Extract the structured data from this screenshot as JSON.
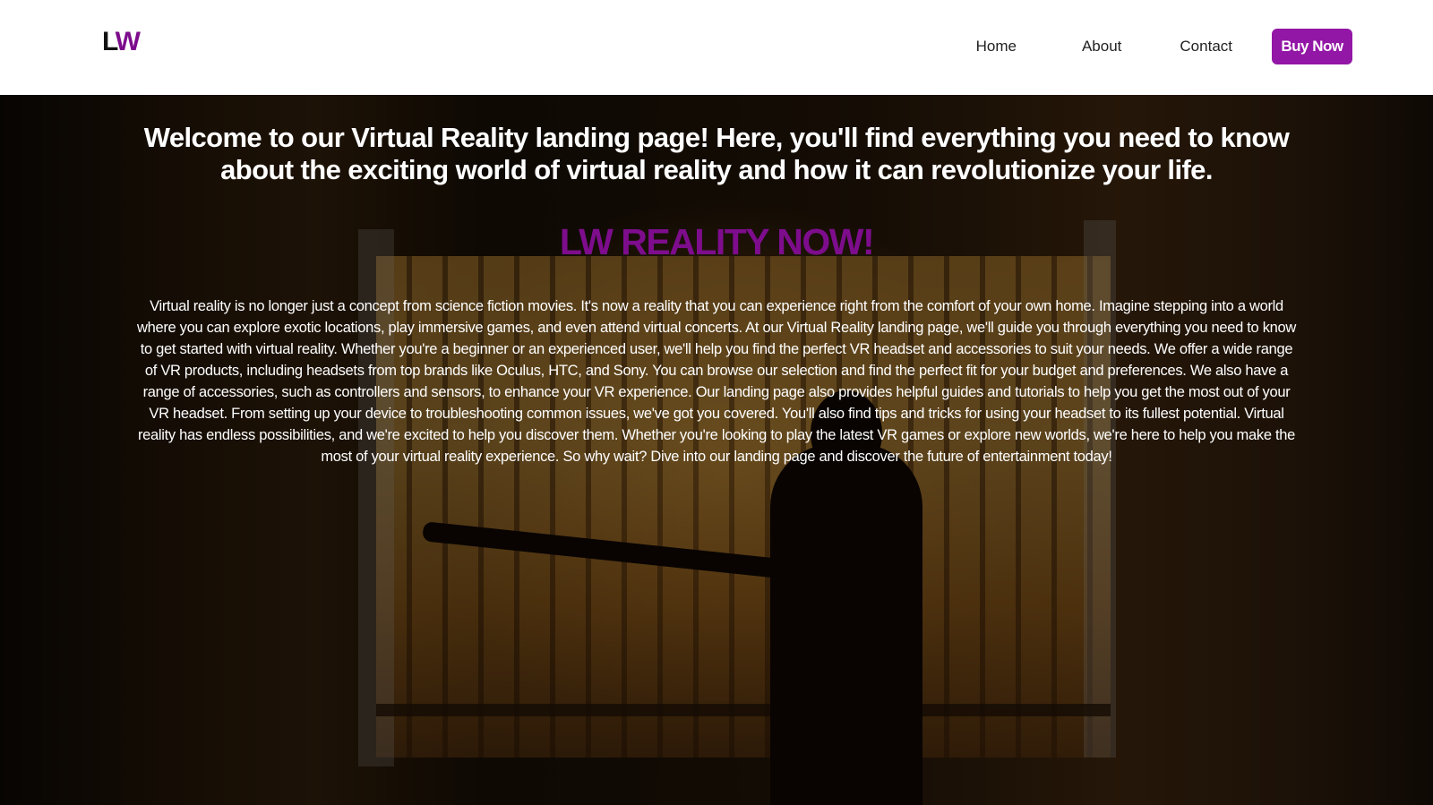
{
  "header": {
    "logo": {
      "left": "L",
      "right": "W"
    },
    "nav": {
      "home": "Home",
      "about": "About",
      "contact": "Contact",
      "buy_now": "Buy Now"
    }
  },
  "hero": {
    "headline": "Welcome to our Virtual Reality landing page! Here, you'll find everything you need to know about the exciting world of virtual reality and how it can revolutionize your life.",
    "subheadline": "LW REALITY NOW!",
    "body": "Virtual reality is no longer just a concept from science fiction movies. It's now a reality that you can experience right from the comfort of your own home. Imagine stepping into a world where you can explore exotic locations, play immersive games, and even attend virtual concerts. At our Virtual Reality landing page, we'll guide you through everything you need to know to get started with virtual reality. Whether you're a beginner or an experienced user, we'll help you find the perfect VR headset and accessories to suit your needs. We offer a wide range of VR products, including headsets from top brands like Oculus, HTC, and Sony. You can browse our selection and find the perfect fit for your budget and preferences. We also have a range of accessories, such as controllers and sensors, to enhance your VR experience. Our landing page also provides helpful guides and tutorials to help you get the most out of your VR headset. From setting up your device to troubleshooting common issues, we've got you covered. You'll also find tips and tricks for using your headset to its fullest potential. Virtual reality has endless possibilities, and we're excited to help you discover them. Whether you're looking to play the latest VR games or explore new worlds, we're here to help you make the most of your virtual reality experience. So why wait? Dive into our landing page and discover the future of entertainment today!"
  },
  "colors": {
    "brand_purple": "#9317a6",
    "subheadline_purple": "#7d0d8c",
    "nav_text": "#222222"
  }
}
